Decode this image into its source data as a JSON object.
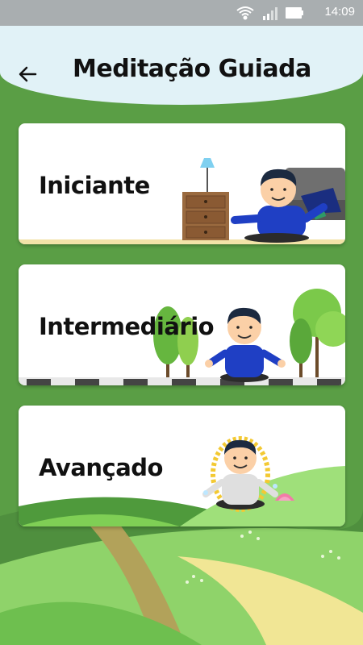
{
  "status": {
    "time": "14:09"
  },
  "header": {
    "title": "Meditação Guiada",
    "back_icon": "arrow-left-icon"
  },
  "levels": [
    {
      "label": "Iniciante",
      "scene": "bedroom"
    },
    {
      "label": "Intermediário",
      "scene": "park"
    },
    {
      "label": "Avançado",
      "scene": "hills"
    }
  ],
  "colors": {
    "header_bg": "#e1f2f7",
    "background": "#5a9e45",
    "shirt": "#1f3fc4"
  }
}
